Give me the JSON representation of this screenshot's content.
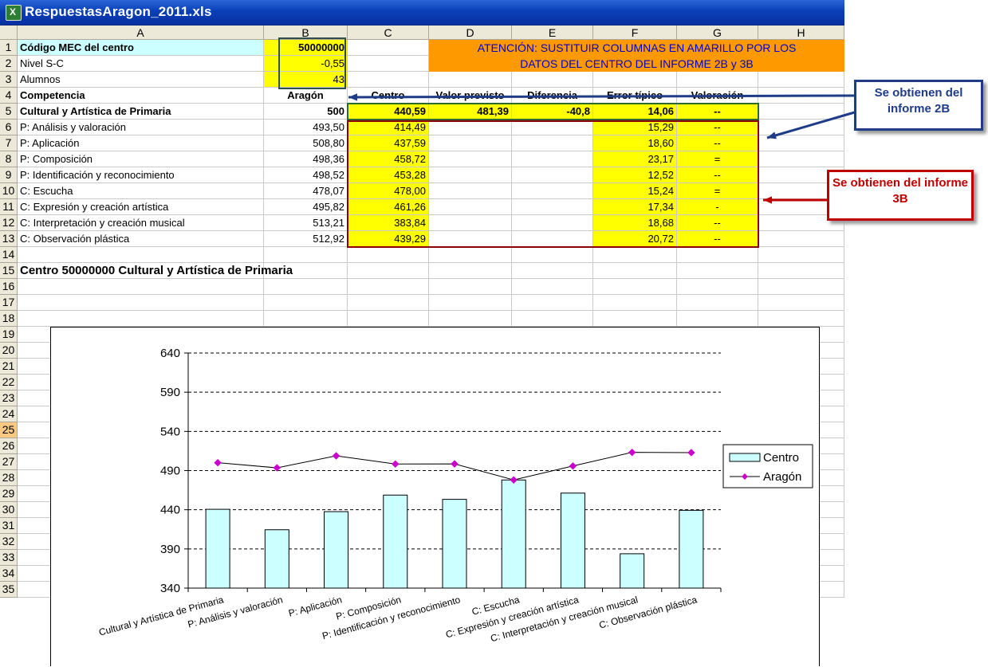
{
  "window": {
    "title": "RespuestasAragon_2011.xls"
  },
  "columns": [
    "A",
    "B",
    "C",
    "D",
    "E",
    "F",
    "G",
    "H"
  ],
  "rows": [
    "1",
    "2",
    "3",
    "4",
    "5",
    "6",
    "7",
    "8",
    "9",
    "10",
    "11",
    "12",
    "13",
    "14",
    "15",
    "16",
    "17",
    "18",
    "19",
    "20",
    "21",
    "22",
    "23",
    "24",
    "25",
    "26",
    "27",
    "28",
    "29",
    "30",
    "31",
    "32",
    "33",
    "34",
    "35"
  ],
  "info": {
    "codigo_label": "Código MEC del centro",
    "codigo_value": "50000000",
    "nivel_label": "Nivel S-C",
    "nivel_value": "-0,55",
    "alumnos_label": "Alumnos",
    "alumnos_value": "43"
  },
  "banner": {
    "line1": "ATENCIÓN: SUSTITUIR COLUMNAS EN AMARILLO POR LOS",
    "line2": "DATOS DEL CENTRO DEL INFORME 2B y 3B"
  },
  "headers": {
    "a": "Competencia",
    "b": "Aragón",
    "c": "Centro",
    "d": "Valor previsto",
    "e": "Diferencia",
    "f": "Error típico",
    "g": "Valoración"
  },
  "summary": {
    "name": "Cultural y Artística de Primaria",
    "aragon": "500",
    "centro": "440,59",
    "previsto": "481,39",
    "diferencia": "-40,8",
    "error": "14,06",
    "valoracion": "--"
  },
  "items": [
    {
      "name": "P: Análisis y valoración",
      "aragon": "493,50",
      "centro": "414,49",
      "error": "15,29",
      "valoracion": "--"
    },
    {
      "name": "P: Aplicación",
      "aragon": "508,80",
      "centro": "437,59",
      "error": "18,60",
      "valoracion": "--"
    },
    {
      "name": "P: Composición",
      "aragon": "498,36",
      "centro": "458,72",
      "error": "23,17",
      "valoracion": "="
    },
    {
      "name": "P: Identificación y reconocimiento",
      "aragon": "498,52",
      "centro": "453,28",
      "error": "12,52",
      "valoracion": "--"
    },
    {
      "name": "C: Escucha",
      "aragon": "478,07",
      "centro": "478,00",
      "error": "15,24",
      "valoracion": "="
    },
    {
      "name": "C: Expresión y creación artística",
      "aragon": "495,82",
      "centro": "461,26",
      "error": "17,34",
      "valoracion": "-"
    },
    {
      "name": "C: Interpretación y creación musical",
      "aragon": "513,21",
      "centro": "383,84",
      "error": "18,68",
      "valoracion": "--"
    },
    {
      "name": "C: Observación plástica",
      "aragon": "512,92",
      "centro": "439,29",
      "error": "20,72",
      "valoracion": "--"
    }
  ],
  "chart_title": "Centro 50000000 Cultural y Artística de Primaria",
  "callouts": {
    "informe_2b": "Se obtienen del informe 2B",
    "informe_3b": "Se obtienen del informe 3B"
  },
  "colors": {
    "yellow": "#ffff00",
    "orange": "#ff9900",
    "cyan": "#ccffff",
    "marker": "#cc00cc",
    "callout_2b": "#1f3c88",
    "callout_3b": "#c00000"
  },
  "chart_data": {
    "type": "bar",
    "categories": [
      "Cultural y Artística de Primaria",
      "P: Análisis y valoración",
      "P: Aplicación",
      "P: Composición",
      "P: Identificación y reconocimiento",
      "C: Escucha",
      "C: Expresión y creación artística",
      "C: Interpretación y creación musical",
      "C: Observación plástica"
    ],
    "series": [
      {
        "name": "Centro",
        "type": "bar",
        "values": [
          440.59,
          414.49,
          437.59,
          458.72,
          453.28,
          478.0,
          461.26,
          383.84,
          439.29
        ]
      },
      {
        "name": "Aragón",
        "type": "line",
        "values": [
          500,
          493.5,
          508.8,
          498.36,
          498.52,
          478.07,
          495.82,
          513.21,
          512.92
        ]
      }
    ],
    "ylim": [
      340,
      640
    ],
    "yticks": [
      340,
      390,
      440,
      490,
      540,
      590,
      640
    ],
    "grid": "dashed horizontal",
    "legend": "right"
  }
}
